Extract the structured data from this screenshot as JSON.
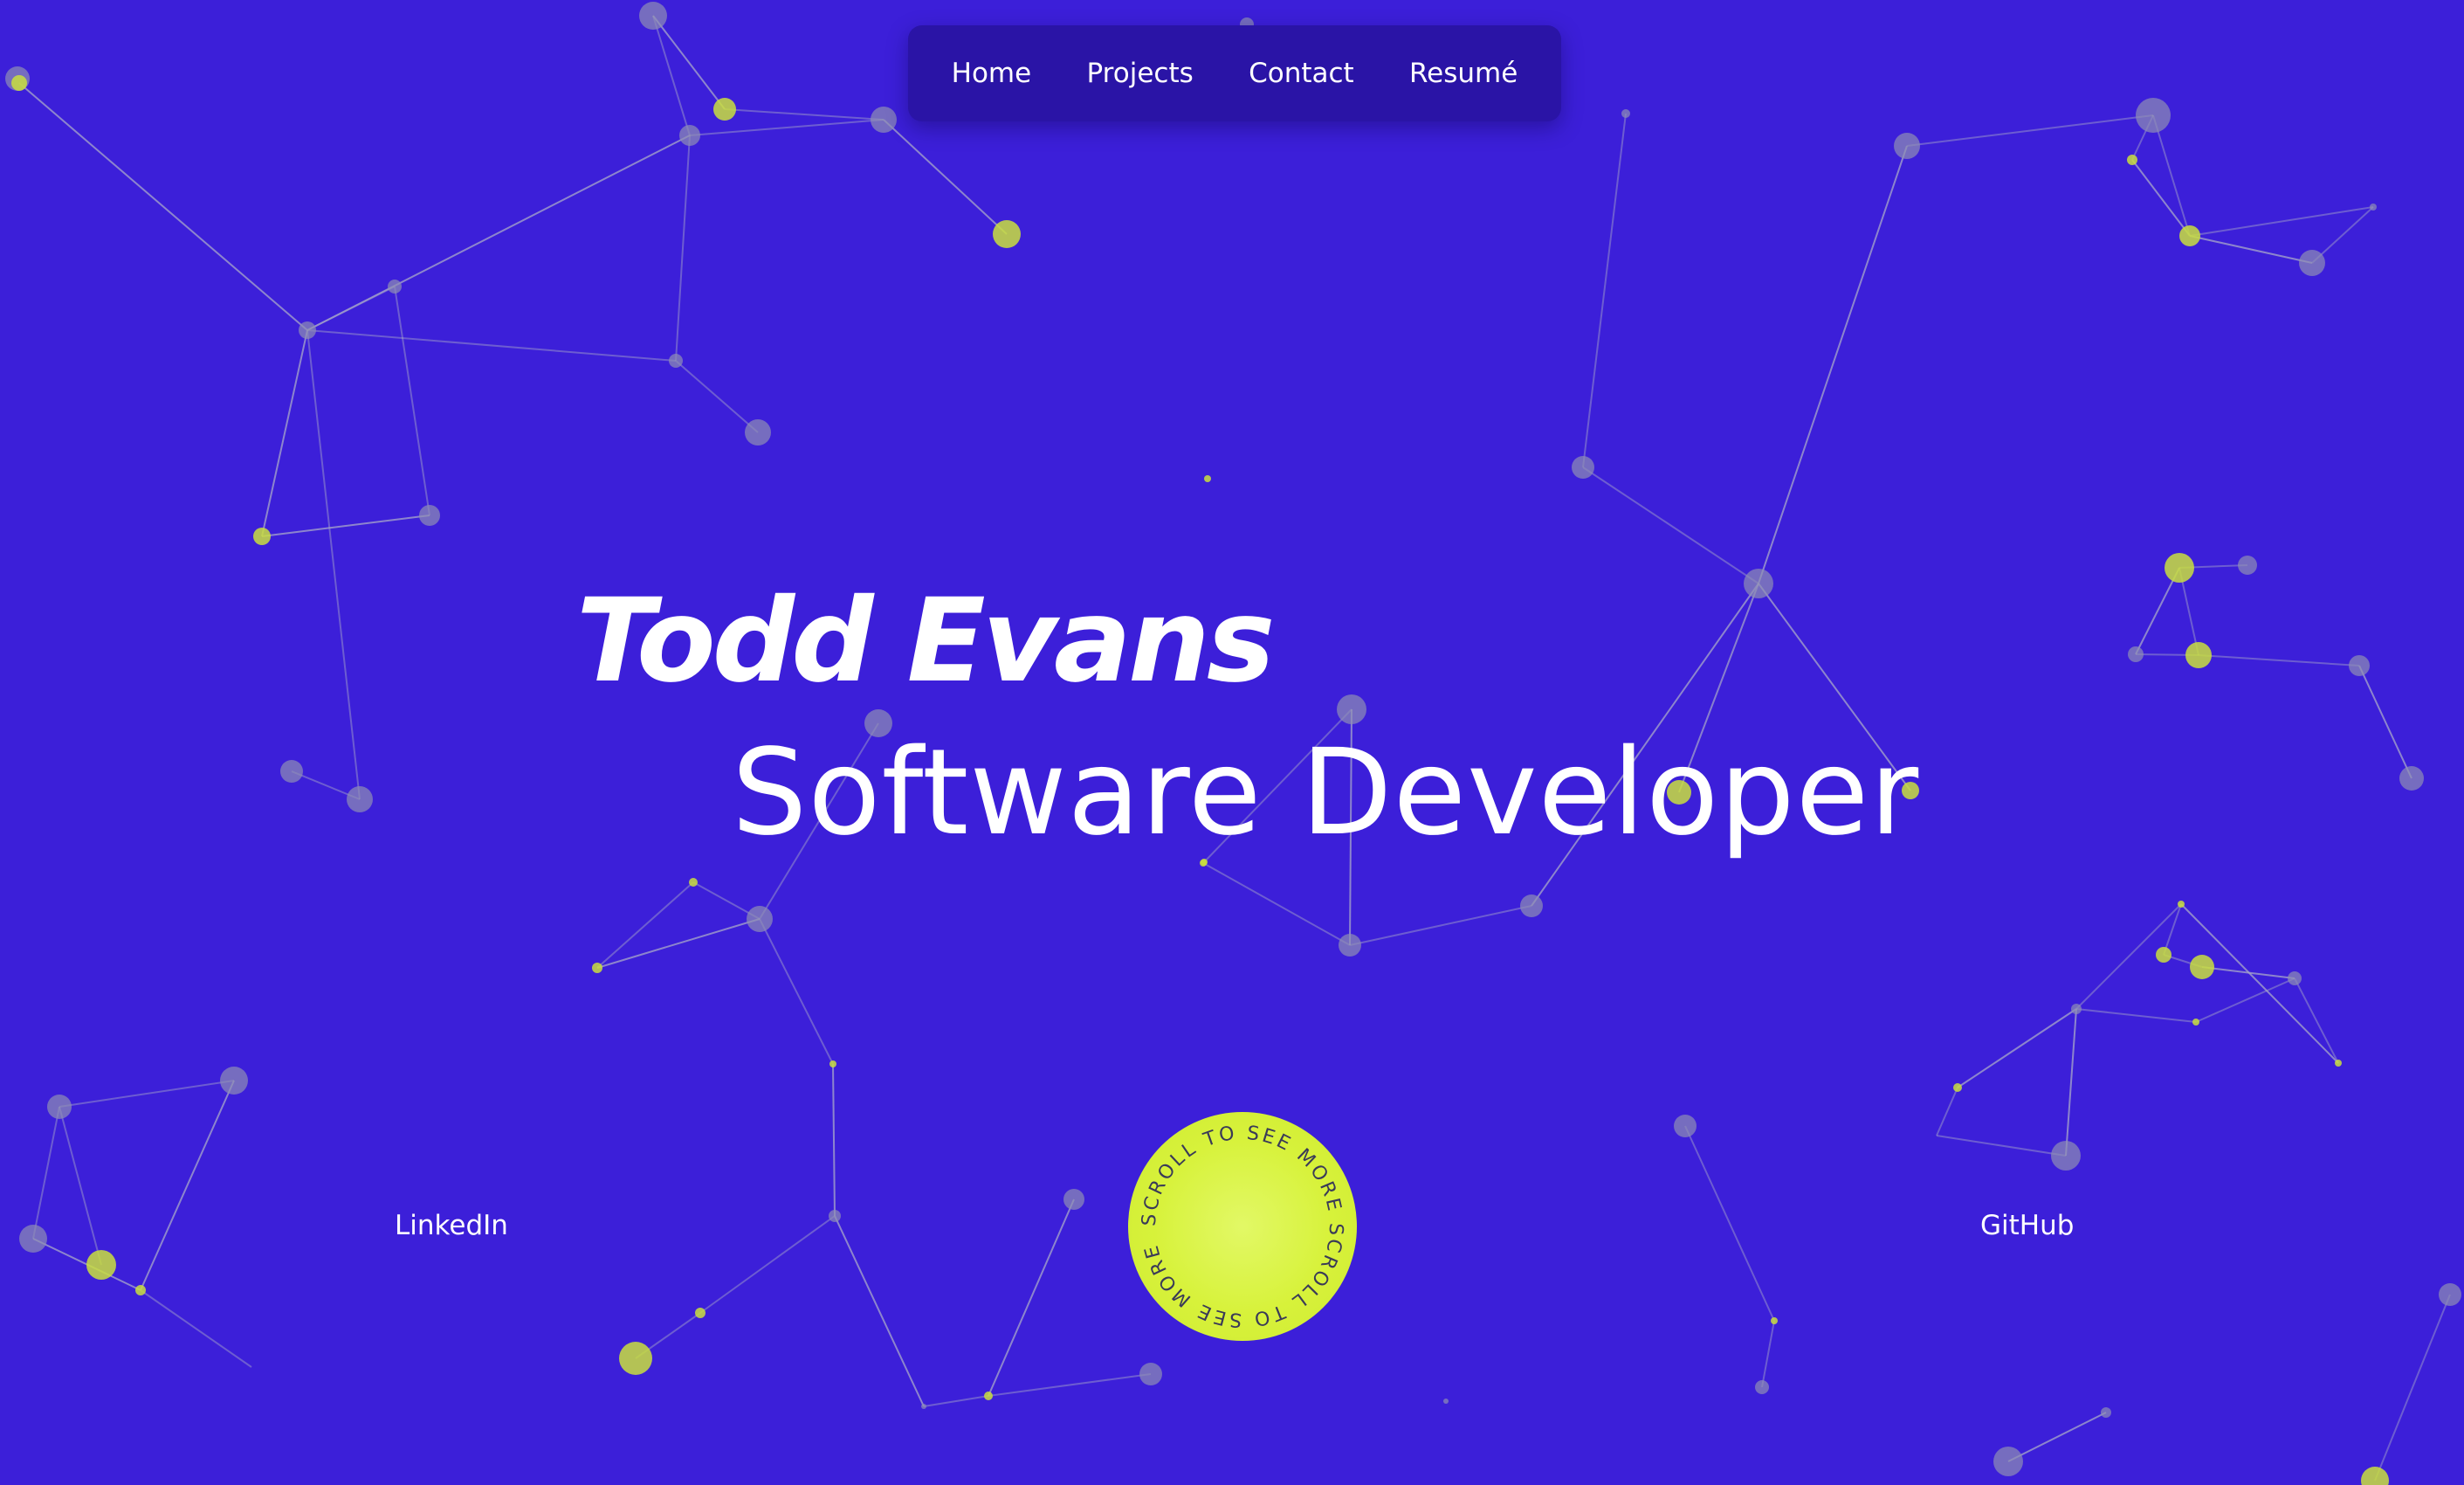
{
  "theme": {
    "background": "#3c1fd9",
    "nav_background": "#2a14a6",
    "accent": "#d7f23a",
    "node_gray": "#8f8fb4",
    "node_lime": "#c9df3d",
    "line_color": "#a8a8c8"
  },
  "nav": {
    "items": [
      {
        "label": "Home"
      },
      {
        "label": "Projects"
      },
      {
        "label": "Contact"
      },
      {
        "label": "Resumé"
      }
    ]
  },
  "hero": {
    "name": "Todd Evans",
    "role": "Software Developer"
  },
  "footer": {
    "linkedin_label": "LinkedIn",
    "github_label": "GitHub",
    "scroll_label": "SCROLL TO SEE MORE SCROLL TO SEE MORE"
  }
}
